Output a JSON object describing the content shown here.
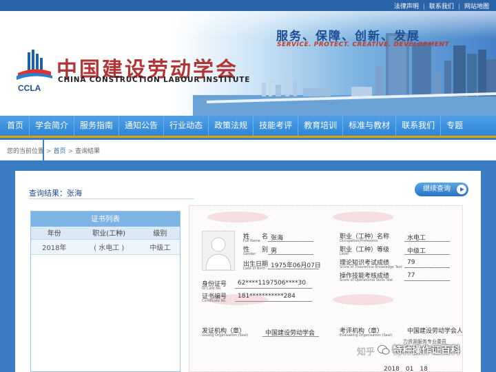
{
  "toplinks": [
    "法律声明",
    "联系我们",
    "网站地图"
  ],
  "toplinks_sep": "|",
  "slogan": {
    "cn": "服务、保障、创新、发展",
    "en": "SERVICE. PROTECT. CREATIVE. DEVELOPMENT"
  },
  "logo": {
    "abbr": "CCLA",
    "cn": "中国建设劳动学会",
    "en": "CHINA CONSTRUCTION LABOUR INSTITUTE"
  },
  "nav": [
    "首页",
    "学会简介",
    "服务指南",
    "通知公告",
    "行业动态",
    "政策法规",
    "技能考评",
    "教育培训",
    "标准与教材",
    "联系我们",
    "专题"
  ],
  "breadcrumb": {
    "prefix": "您的当前位置",
    "items": [
      "首页",
      "查询结果"
    ],
    "sep": ">"
  },
  "result": {
    "title": "查询结果：张海",
    "continue_label": "继续查询"
  },
  "cert_list": {
    "heading": "证书列表",
    "columns": [
      "年份",
      "职业(工种)",
      "级别"
    ],
    "rows": [
      {
        "year": "2018年",
        "job": "( 水电工 )",
        "level": "中级工"
      }
    ]
  },
  "certificate": {
    "name_label": "姓　　名",
    "name_en": "Full Name",
    "name": "张海",
    "gender_label": "性　　别",
    "gender_en": "Gender",
    "gender": "男",
    "dob_label": "出生日期",
    "dob_en": "Date of Birth",
    "dob": "1975年06月07日",
    "id_label": "身份证号",
    "id_en": "ID Card No.",
    "id": "62****1197506****30",
    "cert_no_label": "证书编号",
    "cert_no_en": "Certificate No.",
    "cert_no": "181***********284",
    "job_label": "职业（工种）名称",
    "job_en": "Occupation/Profession",
    "job": "水电工",
    "level_label": "职业（工种）等级",
    "level_en": "Level",
    "level": "中级工",
    "theory_label": "理论知识考试成绩",
    "theory_en": "Score of Theoretical Knowledge Test",
    "theory": "79",
    "skill_label": "操作技能考核成绩",
    "skill_en": "Score of Operational Skills Test",
    "skill": "77",
    "issuer_label": "发证机构（章）",
    "issuer_en": "Issuing Organisation (Seal)",
    "issuer": "中国建设劳动学会",
    "evaluator_label": "考评机构（章）",
    "evaluator_en": "Evaluating Organisation (Seal)",
    "evaluator_line1": "中国建设劳动学会人",
    "evaluator_line2": "力资源服务专业委员",
    "date": "2018　01　18"
  },
  "watermark": {
    "zhihu": "知乎",
    "text": "特种操作证百科"
  },
  "colors": {
    "topbar": "#2a63a8",
    "nav": "#2f84d6",
    "nav_underline": "#e6a100",
    "page_bg": "#3a7cc4",
    "logo_red": "#b23535",
    "slogan_blue": "#1f4d94"
  },
  "icons": [
    "logo-building-icon",
    "play-icon",
    "person-silhouette-icon",
    "wechat-icon"
  ]
}
